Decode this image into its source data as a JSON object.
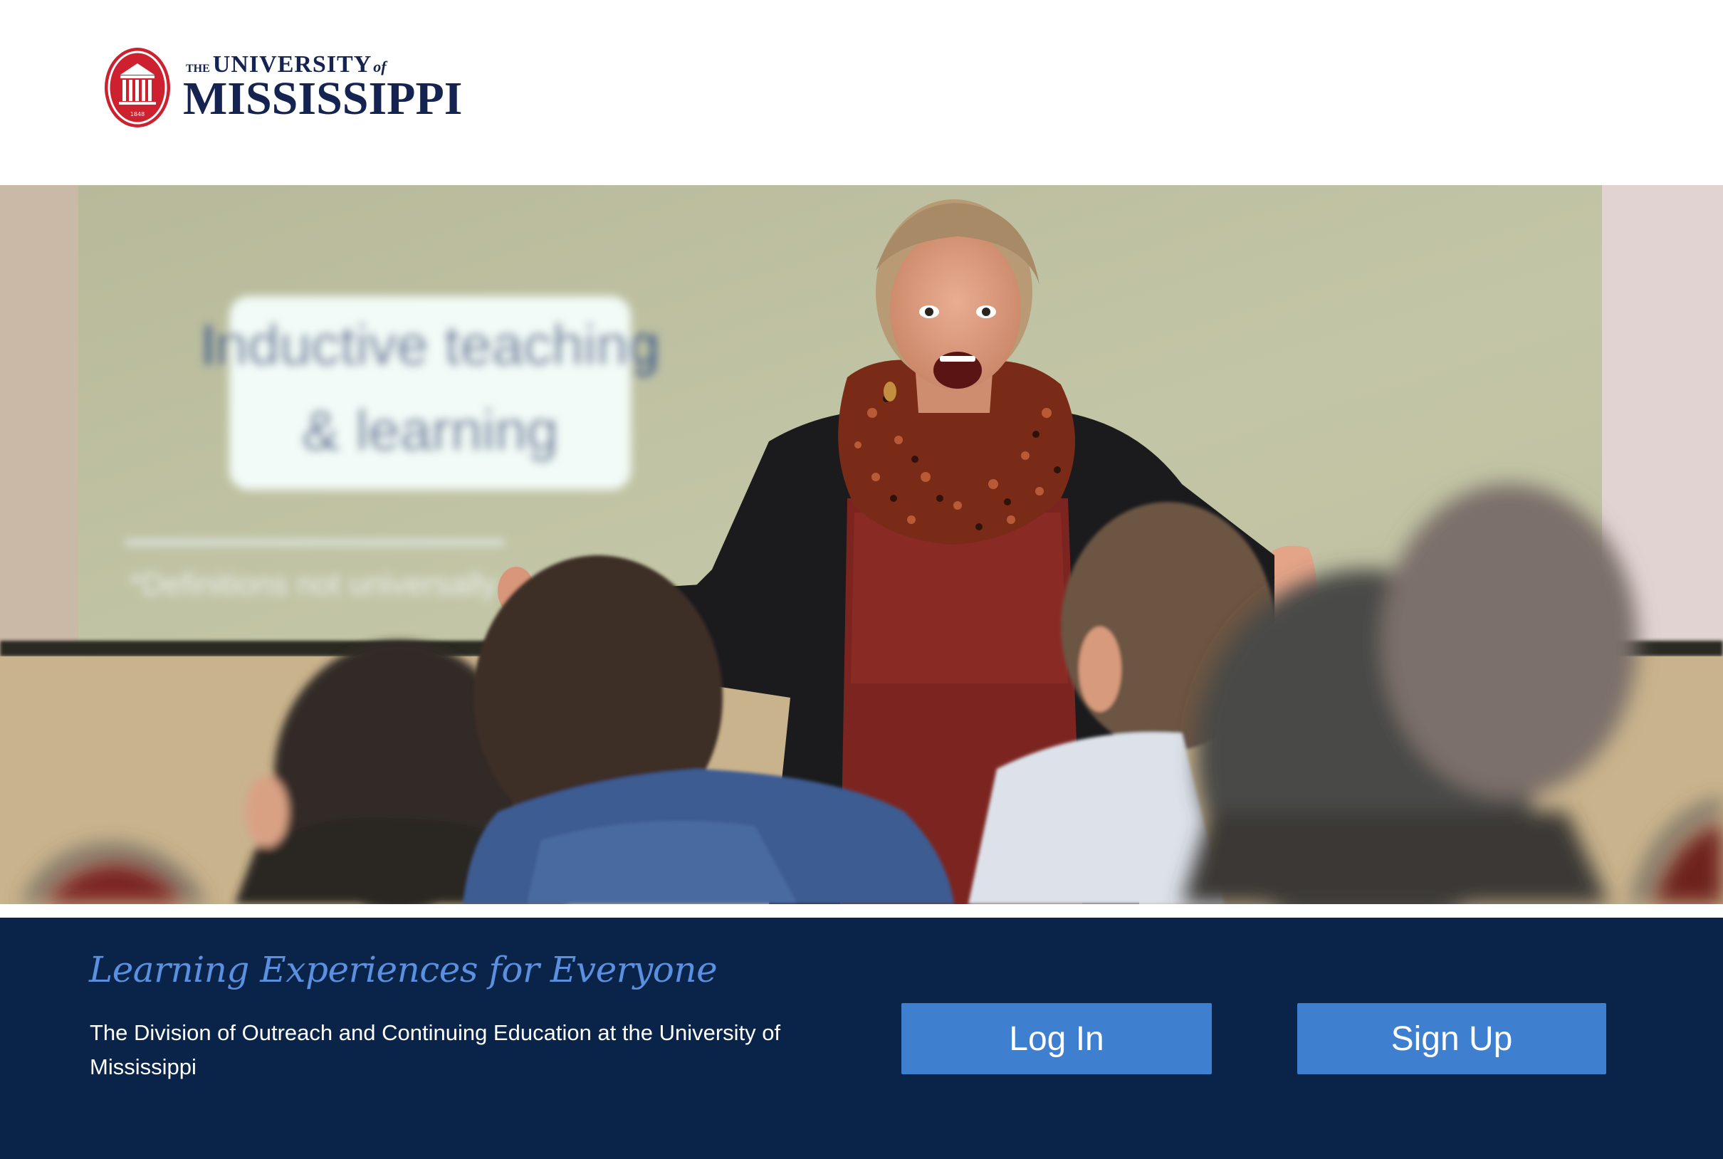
{
  "header": {
    "logo": {
      "the": "THE",
      "university": "UNIVERSITY",
      "of": "of",
      "name": "MISSISSIPPI",
      "seal_year": "1848"
    }
  },
  "hero": {
    "slide_title_line1": "Inductive teaching",
    "slide_title_line2": "& learning",
    "slide_footnote": "*Definitions not universally acc"
  },
  "footer": {
    "tagline": "Learning Experiences for Everyone",
    "description": "The Division of Outreach and Continuing Education at the University of Mississippi",
    "login_label": "Log In",
    "signup_label": "Sign Up"
  },
  "colors": {
    "navy": "#0a2449",
    "button_blue": "#3f7fcf",
    "tagline_blue": "#5b8fe0",
    "seal_red": "#ce2130",
    "wordmark_navy": "#14234f"
  }
}
